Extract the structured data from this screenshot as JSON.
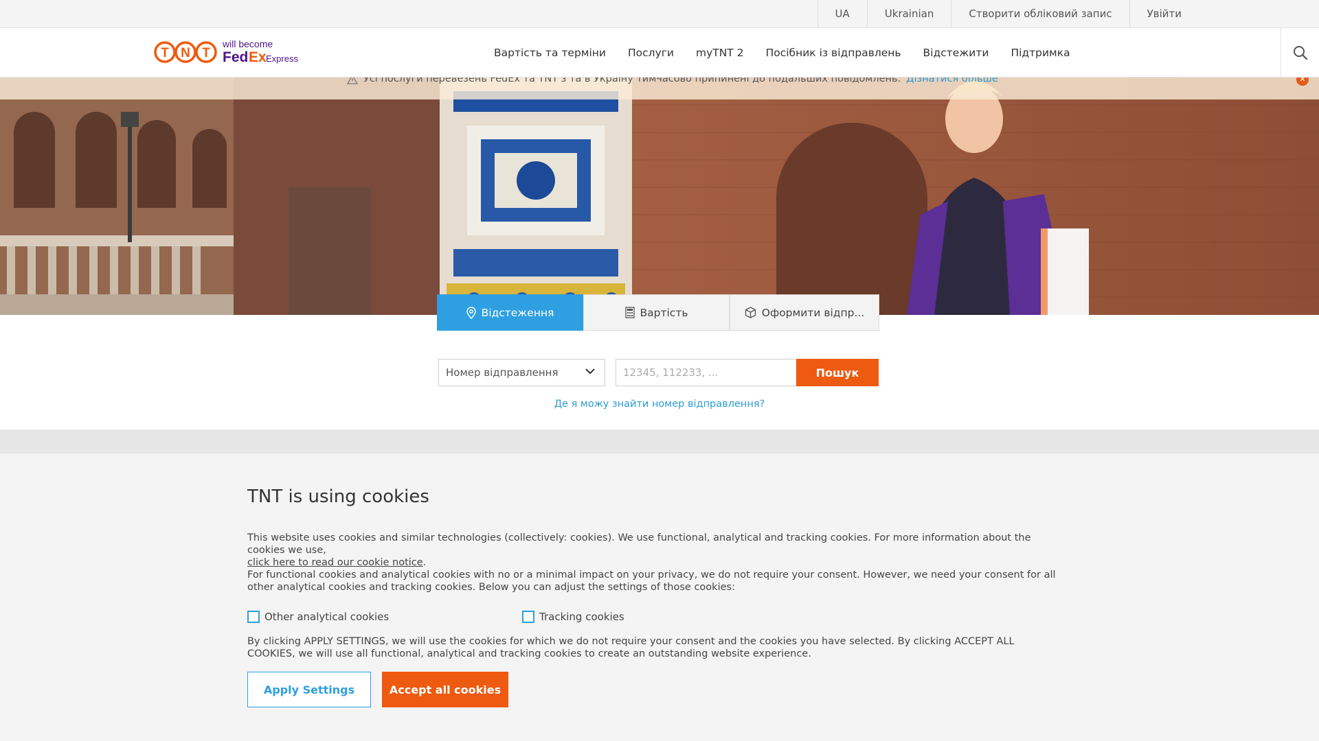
{
  "topbar": {
    "country": "UA",
    "language": "Ukrainian",
    "register": "Створити обліковий запис",
    "login": "Увійти"
  },
  "header": {
    "logo_tnt": "TNT",
    "logo_tagline": "will become",
    "logo_fedex": "FedEx",
    "logo_express": "Express.",
    "nav": [
      "Вартість та терміни",
      "Послуги",
      "myTNT 2",
      "Посібник із відправлень",
      "Відстежити",
      "Підтримка"
    ]
  },
  "notice": {
    "text": "Усі послуги перевезень FedEx та TNT з та в Україну тимчасово припинені до подальших повідомлень.",
    "link": "Дізнатися більше"
  },
  "tabs": [
    {
      "label": "Відстеження",
      "icon": "location-pin-icon"
    },
    {
      "label": "Вартість",
      "icon": "calculator-icon"
    },
    {
      "label": "Оформити відпр...",
      "icon": "package-icon"
    }
  ],
  "track": {
    "select_value": "Номер відправлення",
    "input_placeholder": "12345, 112233, ...",
    "search_label": "Пошук",
    "help_link": "Де я можу знайти номер відправлення?"
  },
  "cookie": {
    "title": "TNT is using cookies",
    "p1": "This website uses cookies and similar technologies (collectively: cookies). We use functional, analytical and tracking cookies. For more information about the cookies we use,",
    "p1_link": "click here to read our cookie notice",
    "p2": "For functional cookies and analytical cookies with no or a minimal impact on your privacy, we do not require your consent. However, we need your consent for all other analytical cookies and tracking cookies. Below you can adjust the settings of those cookies:",
    "opt1": "Other analytical cookies",
    "opt2": "Tracking cookies",
    "p3": "By clicking APPLY SETTINGS, we will use the cookies for which we do not require your consent and the cookies you have selected. By clicking ACCEPT ALL COOKIES, we will use all functional, analytical and tracking cookies to create an outstanding website experience.",
    "apply": "Apply Settings",
    "accept": "Accept all cookies"
  },
  "colors": {
    "orange": "#ee5a10",
    "blue": "#2e9fe0",
    "fedex_purple": "#4d148c"
  }
}
